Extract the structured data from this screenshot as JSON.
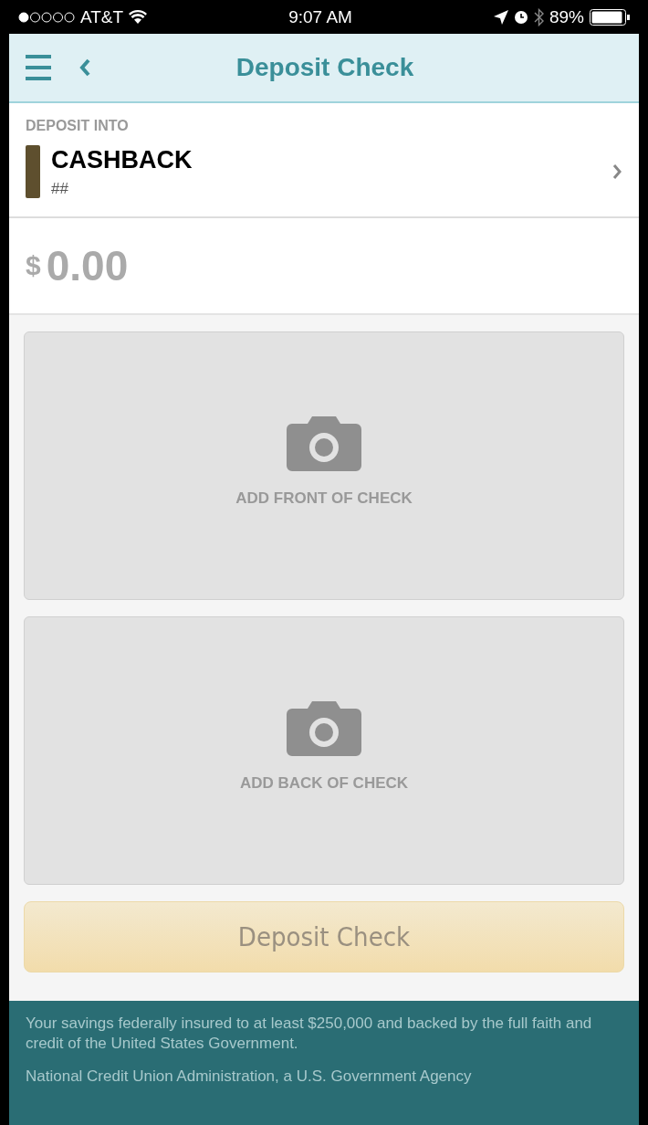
{
  "status_bar": {
    "carrier": "AT&T",
    "time": "9:07 AM",
    "battery": "89%"
  },
  "header": {
    "title": "Deposit Check"
  },
  "deposit_into": {
    "label": "DEPOSIT INTO",
    "account_name": "CASHBACK",
    "account_number": "##"
  },
  "amount": {
    "currency": "$",
    "value": "0.00"
  },
  "capture_cards": [
    {
      "label": "ADD FRONT OF CHECK"
    },
    {
      "label": "ADD BACK OF CHECK"
    }
  ],
  "deposit_button": {
    "label": "Deposit Check",
    "disabled": true
  },
  "footer": {
    "lines": [
      "Your savings federally insured to at least $250,000 and backed by the full faith and credit of the United States Government.",
      "National Credit Union Administration, a U.S. Government Agency"
    ]
  }
}
